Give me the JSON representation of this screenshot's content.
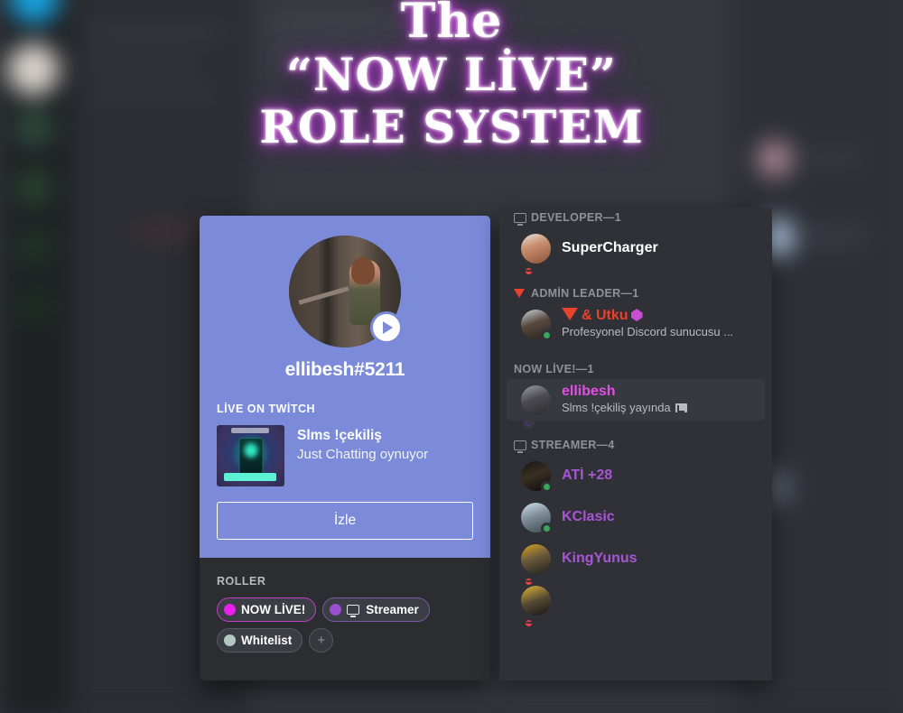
{
  "title": {
    "line1": "The",
    "line2": "“NOW LİVE”",
    "line3": "ROLE SYSTEM",
    "glow_color": "#c35ad6"
  },
  "profile_card": {
    "username": "ellibesh#5211",
    "avatar_alt": "avatar",
    "play_badge_icon": "play-icon",
    "stream": {
      "section_label": "LİVE ON TWİTCH",
      "title": "Slms !çekiliş",
      "subtitle": "Just Chatting oynuyor",
      "thumbnail_alt": "stream-thumbnail"
    },
    "watch_button": "İzle",
    "roles": {
      "section_label": "ROLLER",
      "items": [
        {
          "label": "NOW LİVE!",
          "dot_color": "#ea1fea",
          "border_color": "#c23ec2",
          "icon": null
        },
        {
          "label": "Streamer",
          "dot_color": "#9b4fd0",
          "border_color": "#7a5aa8",
          "icon": "monitor-icon"
        },
        {
          "label": "Whitelist",
          "dot_color": "#b4c7c0",
          "border_color": "#56585f",
          "icon": null
        }
      ],
      "add_label": "+"
    },
    "banner_color": "#7b8bd9",
    "body_color": "#2c2d31"
  },
  "member_list": {
    "groups": [
      {
        "icon": "monitor-icon",
        "label": "DEVELOPER—1",
        "members": [
          {
            "name": "SuperCharger",
            "name_color": "#ffffff",
            "status": "dnd",
            "sub": null,
            "avatar_hue": "skin"
          }
        ]
      },
      {
        "icon": "red-triangle-icon",
        "label": "ADMİN LEADER—1",
        "members": [
          {
            "name": "& Utku",
            "name_color": "#e8412c",
            "status": "online",
            "sub": "Profesyonel Discord sunucusu ...",
            "prefix_icon": "red-triangle-icon",
            "suffix_icon": "gem-icon",
            "avatar_hue": "glasses"
          }
        ]
      },
      {
        "icon": null,
        "label": "NOW LİVE!—1",
        "members": [
          {
            "name": "ellibesh",
            "name_color": "#e44ee4",
            "status": "streaming",
            "sub": "Slms !çekiliş yayında",
            "sub_icon": "stream-icon",
            "highlighted": true,
            "avatar_hue": "grey"
          }
        ]
      },
      {
        "icon": "monitor-icon",
        "label": "STREAMER—4",
        "members": [
          {
            "name": "ATİ +28",
            "name_color": "#a855d4",
            "status": "online",
            "sub": null,
            "avatar_hue": "dark"
          },
          {
            "name": "KClasic",
            "name_color": "#a855d4",
            "status": "online",
            "sub": null,
            "avatar_hue": "sky"
          },
          {
            "name": "KingYunus",
            "name_color": "#a855d4",
            "status": "dnd",
            "sub": null,
            "avatar_hue": "gold"
          },
          {
            "name": "",
            "name_color": "#a855d4",
            "status": "dnd",
            "sub": null,
            "avatar_hue": "gold2"
          }
        ]
      }
    ],
    "panel_color": "#2f3136"
  }
}
